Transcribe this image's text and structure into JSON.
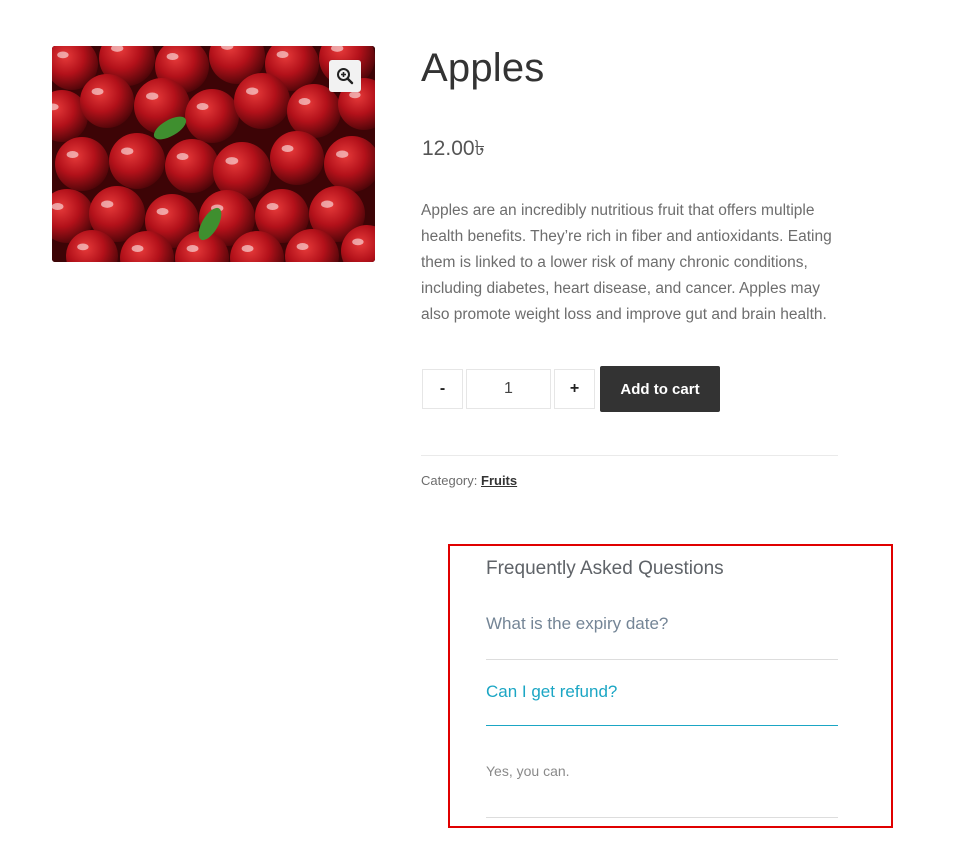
{
  "product": {
    "title": "Apples",
    "price": "12.00৳",
    "description": "Apples are an incredibly nutritious fruit that offers multiple health benefits. They’re rich in fiber and antioxidants. Eating them is linked to a lower risk of many chronic conditions, including diabetes, heart disease, and cancer. Apples may also promote weight loss and improve gut and brain health.",
    "image_icon": "zoom-in-icon"
  },
  "cart": {
    "minus_label": "-",
    "quantity": "1",
    "plus_label": "+",
    "add_label": "Add to cart"
  },
  "meta": {
    "category_prefix": "Category:",
    "category_link": "Fruits"
  },
  "faq": {
    "heading": "Frequently Asked Questions",
    "items": [
      {
        "question": "What is the expiry date?",
        "expanded": false
      },
      {
        "question": "Can I get refund?",
        "expanded": true,
        "answer": "Yes, you can."
      }
    ]
  },
  "colors": {
    "accent": "#1ba6c4",
    "highlight_border": "#e00000",
    "button_bg": "#333333"
  }
}
